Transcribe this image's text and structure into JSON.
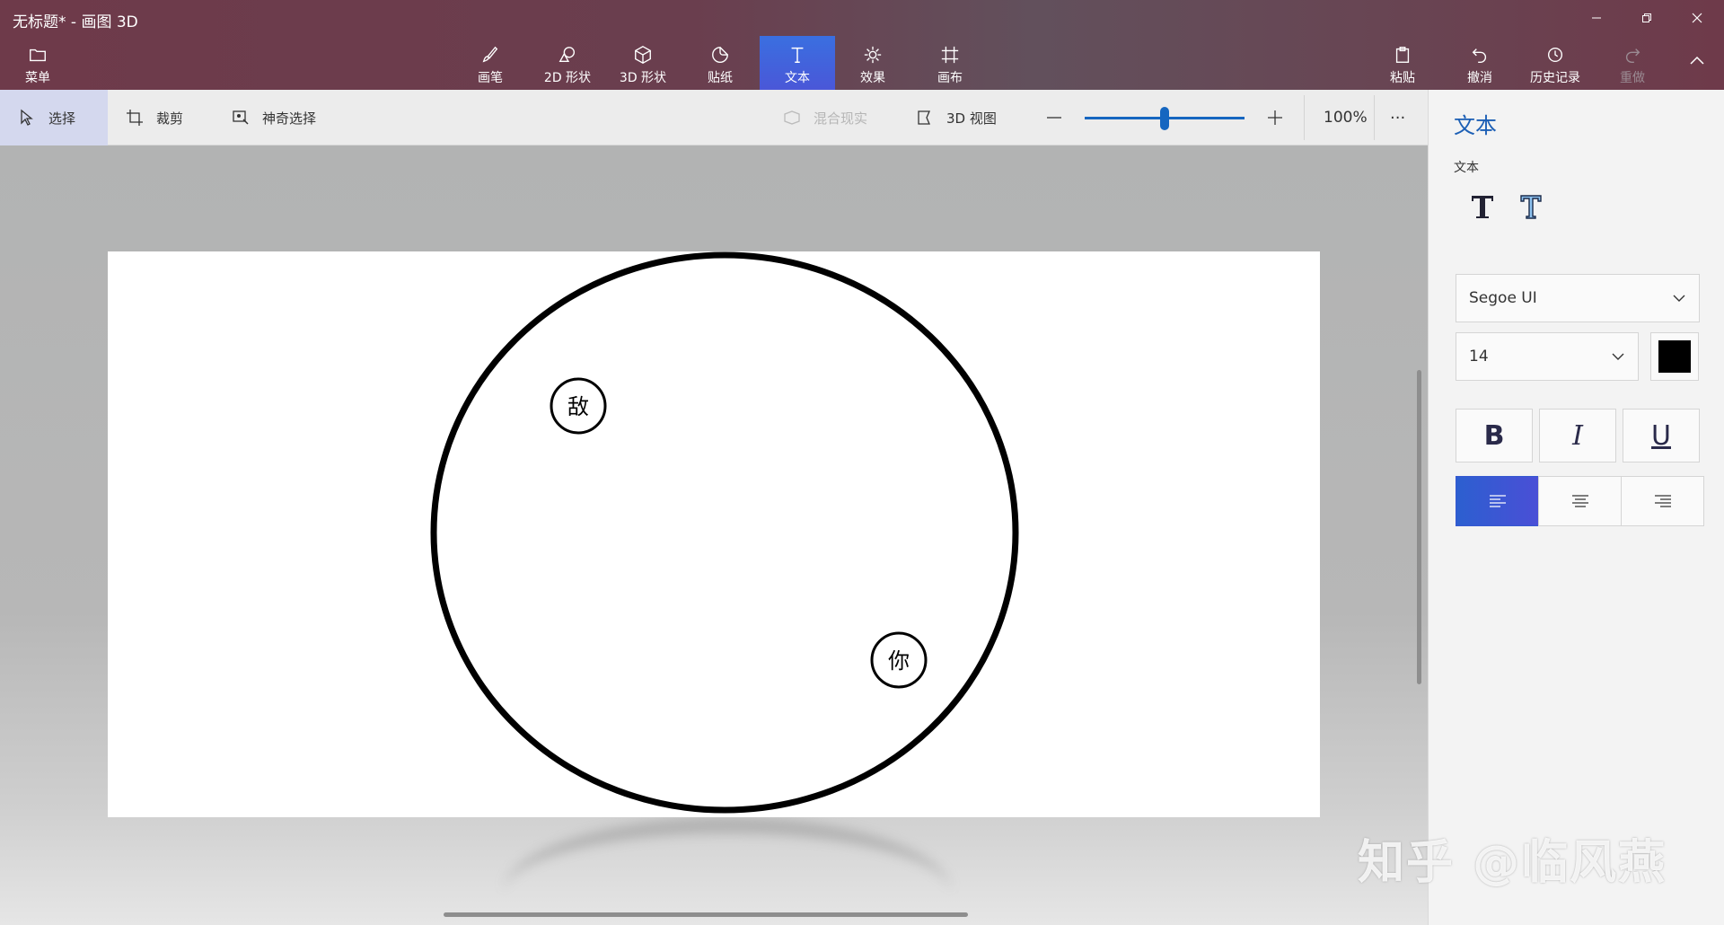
{
  "window": {
    "title": "无标题* - 画图 3D",
    "min_icon": "minimize-icon",
    "restore_icon": "restore-icon",
    "close_icon": "close-icon"
  },
  "ribbon": {
    "menu_label": "菜单",
    "tools": [
      {
        "label": "画笔",
        "icon": "brush-icon"
      },
      {
        "label": "2D 形状",
        "icon": "2d-shapes-icon"
      },
      {
        "label": "3D 形状",
        "icon": "3d-shapes-icon"
      },
      {
        "label": "贴纸",
        "icon": "sticker-icon"
      },
      {
        "label": "文本",
        "icon": "text-icon"
      },
      {
        "label": "效果",
        "icon": "effects-icon"
      },
      {
        "label": "画布",
        "icon": "canvas-icon"
      }
    ],
    "paste_label": "粘贴",
    "undo_label": "撤消",
    "history_label": "历史记录",
    "redo_label": "重做"
  },
  "toolbar": {
    "select_label": "选择",
    "crop_label": "裁剪",
    "magic_select_label": "神奇选择",
    "mixed_reality_label": "混合现实",
    "view3d_label": "3D 视图",
    "zoom_value": "100%",
    "zoom_level": 0.5,
    "more_label": "···"
  },
  "canvas": {
    "enemy_label": "敌",
    "you_label": "你"
  },
  "panel": {
    "title": "文本",
    "subtitle": "文本",
    "font_name": "Segoe UI",
    "font_size": "14",
    "text_color": "#000000",
    "bold_label": "B",
    "italic_label": "I",
    "underline_label": "U"
  },
  "watermark": "知乎 @临风燕",
  "colors": {
    "accent": "#1566c0",
    "active_tab": "#3a6fe0"
  }
}
